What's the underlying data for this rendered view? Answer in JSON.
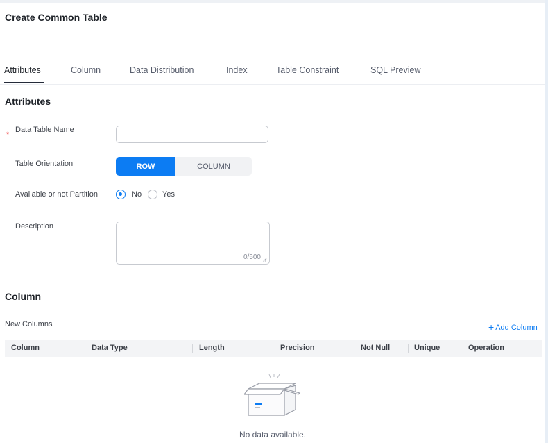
{
  "page": {
    "title": "Create Common Table"
  },
  "tabs": [
    {
      "label": "Attributes",
      "active": true
    },
    {
      "label": "Column"
    },
    {
      "label": "Data Distribution"
    },
    {
      "label": "Index"
    },
    {
      "label": "Table Constraint"
    },
    {
      "label": "SQL Preview"
    }
  ],
  "attributes": {
    "title": "Attributes",
    "table_name": {
      "label": "Data Table Name",
      "required": true,
      "value": ""
    },
    "orientation": {
      "label": "Table Orientation",
      "options": [
        "ROW",
        "COLUMN"
      ],
      "selected": "ROW"
    },
    "partition": {
      "label": "Available or not Partition",
      "options": [
        "No",
        "Yes"
      ],
      "selected": "No"
    },
    "description": {
      "label": "Description",
      "value": "",
      "counter": "0/500"
    }
  },
  "column_section": {
    "title": "Column",
    "subtitle": "New Columns",
    "add_label": "Add Column",
    "headers": [
      "Column",
      "Data Type",
      "Length",
      "Precision",
      "Not Null",
      "Unique",
      "Operation"
    ],
    "rows": [],
    "empty_text": "No data available."
  },
  "colors": {
    "primary": "#0c7cf3",
    "required": "#f04a4a",
    "header_bg": "#f3f4f6"
  }
}
